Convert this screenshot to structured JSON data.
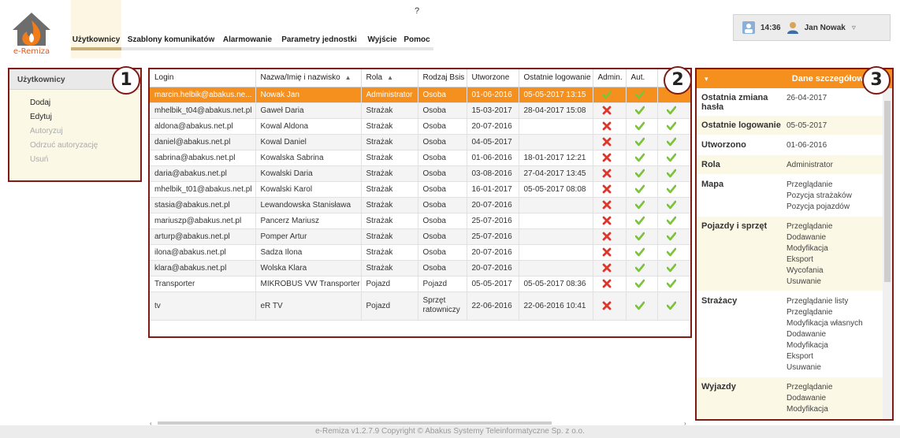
{
  "app": {
    "logo_text": "e-Remiza"
  },
  "nav": [
    {
      "label": "Użytkownicy",
      "icon": "users-icon",
      "active": true
    },
    {
      "label": "Szablony komunikatów",
      "icon": "document-template-icon"
    },
    {
      "label": "Alarmowanie",
      "icon": "bell-icon"
    },
    {
      "label": "Parametry jednostki",
      "icon": "unit-settings-icon"
    },
    {
      "label": "Wyjście",
      "icon": "exit-door-icon"
    },
    {
      "label": "Pomoc",
      "icon": "help-icon"
    }
  ],
  "user": {
    "time": "14:36",
    "name": "Jan Nowak"
  },
  "left_panel": {
    "title": "Użytkownicy",
    "items": [
      {
        "label": "Dodaj",
        "icon": "add-user-icon",
        "enabled": true
      },
      {
        "label": "Edytuj",
        "icon": "edit-icon",
        "enabled": true
      },
      {
        "label": "Autoryzuj",
        "icon": "authorize-icon",
        "enabled": false
      },
      {
        "label": "Odrzuć autoryzację",
        "icon": "reject-icon",
        "enabled": false
      },
      {
        "label": "Usuń",
        "icon": "delete-icon",
        "enabled": false
      }
    ]
  },
  "callouts": [
    "1",
    "2",
    "3"
  ],
  "grid": {
    "columns": [
      "Login",
      "Nazwa/Imię i nazwisko",
      "Rola",
      "Rodzaj Bsis",
      "Utworzone",
      "Ostatnie logowanie",
      "Admin.",
      "Aut.",
      ""
    ],
    "rows": [
      {
        "login": "marcin.helbik@abakus.ne...",
        "name": "Nowak Jan",
        "role": "Administrator",
        "type": "Osoba",
        "created": "01-06-2016",
        "last": "05-05-2017 13:15",
        "admin": true,
        "aut": true,
        "c9": null,
        "selected": true
      },
      {
        "login": "mhelbik_t04@abakus.net.pl",
        "name": "Gaweł Daria",
        "role": "Strażak",
        "type": "Osoba",
        "created": "15-03-2017",
        "last": "28-04-2017 15:08",
        "admin": false,
        "aut": true,
        "c9": true
      },
      {
        "login": "aldona@abakus.net.pl",
        "name": "Kowal Aldona",
        "role": "Strażak",
        "type": "Osoba",
        "created": "20-07-2016",
        "last": "",
        "admin": false,
        "aut": true,
        "c9": true
      },
      {
        "login": "daniel@abakus.net.pl",
        "name": "Kowal Daniel",
        "role": "Strażak",
        "type": "Osoba",
        "created": "04-05-2017",
        "last": "",
        "admin": false,
        "aut": true,
        "c9": true
      },
      {
        "login": "sabrina@abakus.net.pl",
        "name": "Kowalska Sabrina",
        "role": "Strażak",
        "type": "Osoba",
        "created": "01-06-2016",
        "last": "18-01-2017 12:21",
        "admin": false,
        "aut": true,
        "c9": true
      },
      {
        "login": "daria@abakus.net.pl",
        "name": "Kowalski Daria",
        "role": "Strażak",
        "type": "Osoba",
        "created": "03-08-2016",
        "last": "27-04-2017 13:45",
        "admin": false,
        "aut": true,
        "c9": true
      },
      {
        "login": "mhelbik_t01@abakus.net.pl",
        "name": "Kowalski Karol",
        "role": "Strażak",
        "type": "Osoba",
        "created": "16-01-2017",
        "last": "05-05-2017 08:08",
        "admin": false,
        "aut": true,
        "c9": true
      },
      {
        "login": "stasia@abakus.net.pl",
        "name": "Lewandowska Stanisława",
        "role": "Strażak",
        "type": "Osoba",
        "created": "20-07-2016",
        "last": "",
        "admin": false,
        "aut": true,
        "c9": true
      },
      {
        "login": "mariuszp@abakus.net.pl",
        "name": "Pancerz Mariusz",
        "role": "Strażak",
        "type": "Osoba",
        "created": "25-07-2016",
        "last": "",
        "admin": false,
        "aut": true,
        "c9": true
      },
      {
        "login": "arturp@abakus.net.pl",
        "name": "Pomper Artur",
        "role": "Strażak",
        "type": "Osoba",
        "created": "25-07-2016",
        "last": "",
        "admin": false,
        "aut": true,
        "c9": true
      },
      {
        "login": "ilona@abakus.net.pl",
        "name": "Sadza Ilona",
        "role": "Strażak",
        "type": "Osoba",
        "created": "20-07-2016",
        "last": "",
        "admin": false,
        "aut": true,
        "c9": true
      },
      {
        "login": "klara@abakus.net.pl",
        "name": "Wolska Klara",
        "role": "Strażak",
        "type": "Osoba",
        "created": "20-07-2016",
        "last": "",
        "admin": false,
        "aut": true,
        "c9": true
      },
      {
        "login": "Transporter",
        "name": "MIKROBUS VW Transporter",
        "role": "Pojazd",
        "type": "Pojazd",
        "created": "05-05-2017",
        "last": "05-05-2017 08:36",
        "admin": false,
        "aut": true,
        "c9": true
      },
      {
        "login": "tv",
        "name": "eR TV",
        "role": "Pojazd",
        "type": "Sprzęt ratowniczy",
        "created": "22-06-2016",
        "last": "22-06-2016 10:41",
        "admin": false,
        "aut": true,
        "c9": true,
        "tall": true
      }
    ]
  },
  "details": {
    "title": "Dane szczegółowe",
    "rows": [
      {
        "key": "Ostatnia zmiana hasła",
        "values": [
          "26-04-2017"
        ]
      },
      {
        "key": "Ostatnie logowanie",
        "values": [
          "05-05-2017"
        ]
      },
      {
        "key": "Utworzono",
        "values": [
          "01-06-2016"
        ]
      },
      {
        "key": "Rola",
        "values": [
          "Administrator"
        ]
      },
      {
        "key": "Mapa",
        "values": [
          "Przeglądanie",
          "Pozycja strażaków",
          "Pozycja pojazdów"
        ]
      },
      {
        "key": "Pojazdy i sprzęt",
        "values": [
          "Przeglądanie",
          "Dodawanie",
          "Modyfikacja",
          "Eksport",
          "Wycofania",
          "Usuwanie"
        ]
      },
      {
        "key": "Strażacy",
        "values": [
          "Przeglądanie listy",
          "Przeglądanie",
          "Modyfikacja własnych",
          "Dodawanie",
          "Modyfikacja",
          "Eksport",
          "Usuwanie"
        ]
      },
      {
        "key": "Wyjazdy",
        "values": [
          "Przeglądanie",
          "Dodawanie",
          "Modyfikacja"
        ]
      }
    ]
  },
  "footer": "e-Remiza v1.2.7.9 Copyright © Abakus Systemy Teleinformatyczne Sp. z o.o.",
  "colors": {
    "accent": "#f5901e",
    "callout_border": "#7d1b16",
    "panel_bg": "#fcf8e6",
    "check": "#7cc23a",
    "cross": "#e0352b"
  }
}
